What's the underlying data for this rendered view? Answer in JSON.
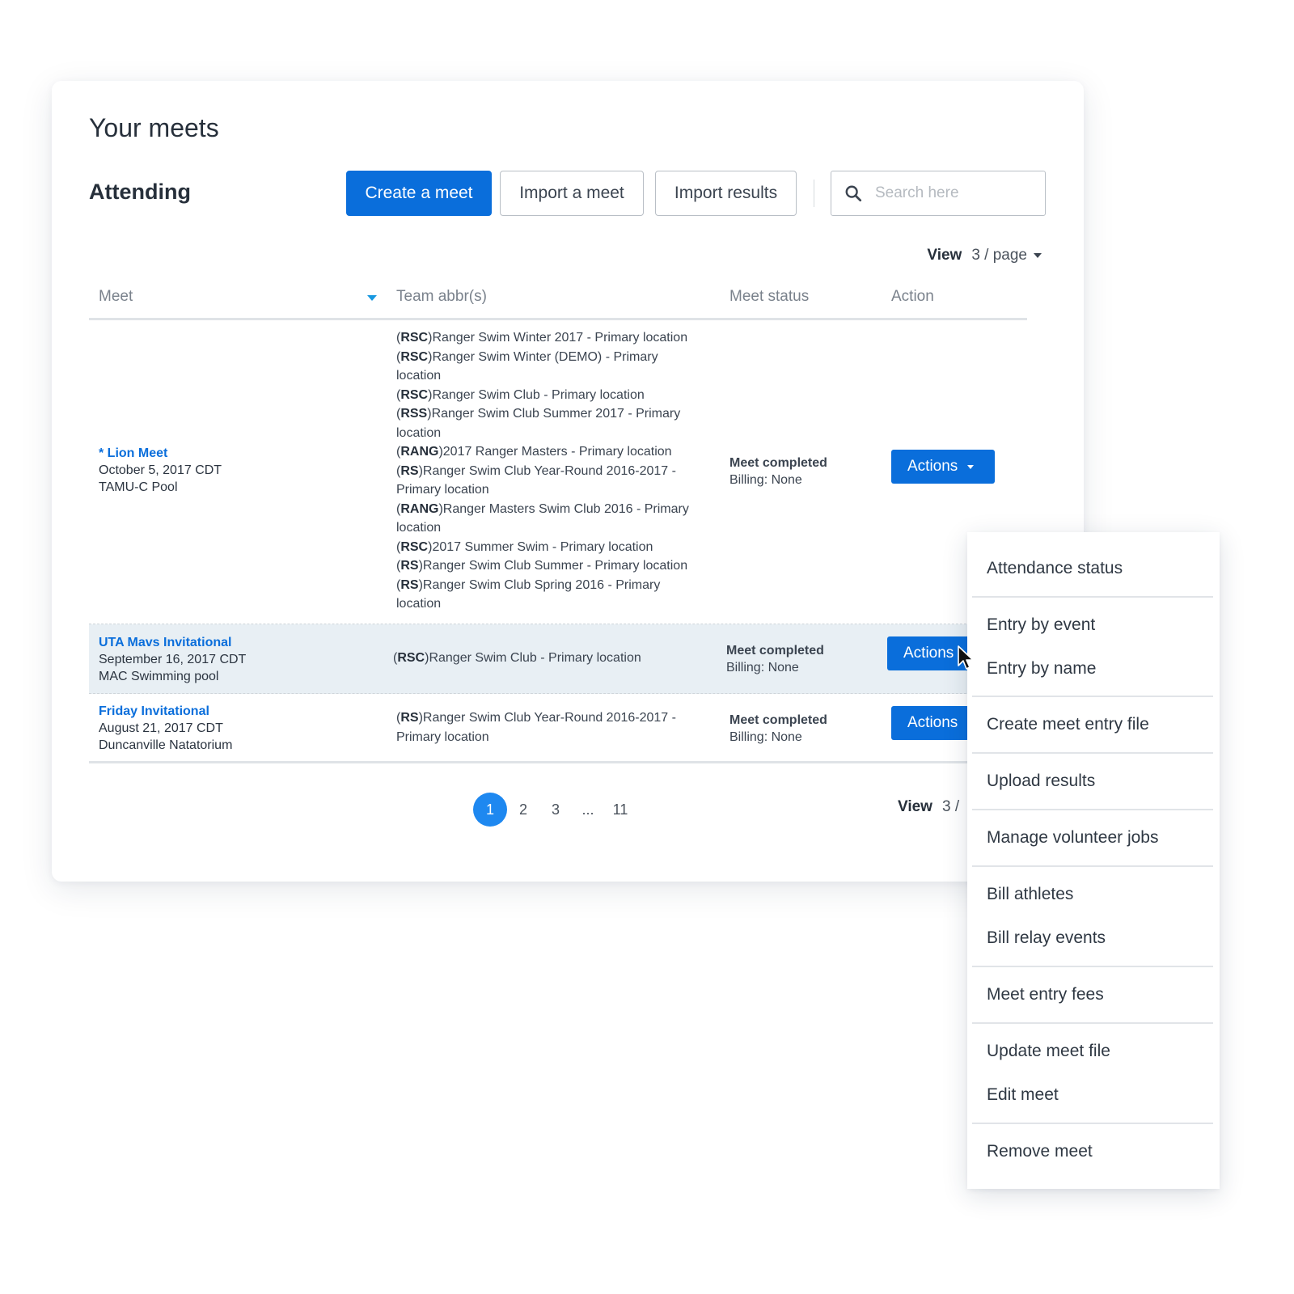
{
  "page": {
    "title": "Your meets",
    "section_title": "Attending"
  },
  "toolbar": {
    "create_label": "Create a meet",
    "import_label": "Import a meet",
    "import_results_label": "Import results",
    "search_placeholder": "Search here"
  },
  "view": {
    "label": "View",
    "value": "3 / page",
    "bottom_value": "3 /"
  },
  "table": {
    "headers": {
      "meet": "Meet",
      "team": "Team abbr(s)",
      "status": "Meet status",
      "action": "Action"
    },
    "rows": [
      {
        "name": "* Lion Meet",
        "date": "October 5, 2017 CDT",
        "venue": "TAMU-C Pool",
        "teams": [
          {
            "abbr": "RSC",
            "name": "Ranger Swim Winter 2017 - Primary location"
          },
          {
            "abbr": "RSC",
            "name": "Ranger Swim Winter (DEMO) - Primary location"
          },
          {
            "abbr": "RSC",
            "name": "Ranger Swim Club - Primary location"
          },
          {
            "abbr": "RSS",
            "name": "Ranger Swim Club Summer 2017 - Primary location"
          },
          {
            "abbr": "RANG",
            "name": "2017 Ranger Masters - Primary location"
          },
          {
            "abbr": "RS",
            "name": "Ranger Swim Club Year-Round 2016-2017 - Primary location"
          },
          {
            "abbr": "RANG",
            "name": "Ranger Masters Swim Club 2016 - Primary location"
          },
          {
            "abbr": "RSC",
            "name": "2017 Summer Swim - Primary location"
          },
          {
            "abbr": "RS",
            "name": "Ranger Swim Club Summer - Primary location"
          },
          {
            "abbr": "RS",
            "name": "Ranger Swim Club Spring 2016 - Primary location"
          }
        ],
        "status": "Meet completed",
        "billing": "Billing: None",
        "action_label": "Actions"
      },
      {
        "name": "UTA Mavs Invitational",
        "date": "September 16, 2017 CDT",
        "venue": "MAC Swimming pool",
        "teams": [
          {
            "abbr": "RSC",
            "name": "Ranger Swim Club - Primary location"
          }
        ],
        "status": "Meet completed",
        "billing": "Billing: None",
        "action_label": "Actions"
      },
      {
        "name": "Friday Invitational",
        "date": "August 21, 2017 CDT",
        "venue": "Duncanville Natatorium",
        "teams": [
          {
            "abbr": "RS",
            "name": "Ranger Swim Club Year-Round 2016-2017 - Primary location"
          }
        ],
        "status": "Meet completed",
        "billing": "Billing: None",
        "action_label": "Actions"
      }
    ]
  },
  "pagination": {
    "pages": [
      "1",
      "2",
      "3",
      "...",
      "11"
    ],
    "current": "1"
  },
  "actions_menu": {
    "items": [
      "Attendance status",
      "Entry by event",
      "Entry by name",
      "Create meet entry file",
      "Upload results",
      "Manage volunteer jobs",
      "Bill athletes",
      "Bill relay events",
      "Meet entry fees",
      "Update meet file",
      "Edit meet",
      "Remove meet"
    ]
  },
  "colors": {
    "primary": "#0a6edb",
    "pager_active": "#1e88f0",
    "hover_row": "#e8eff4",
    "sort_caret": "#1798e0"
  }
}
